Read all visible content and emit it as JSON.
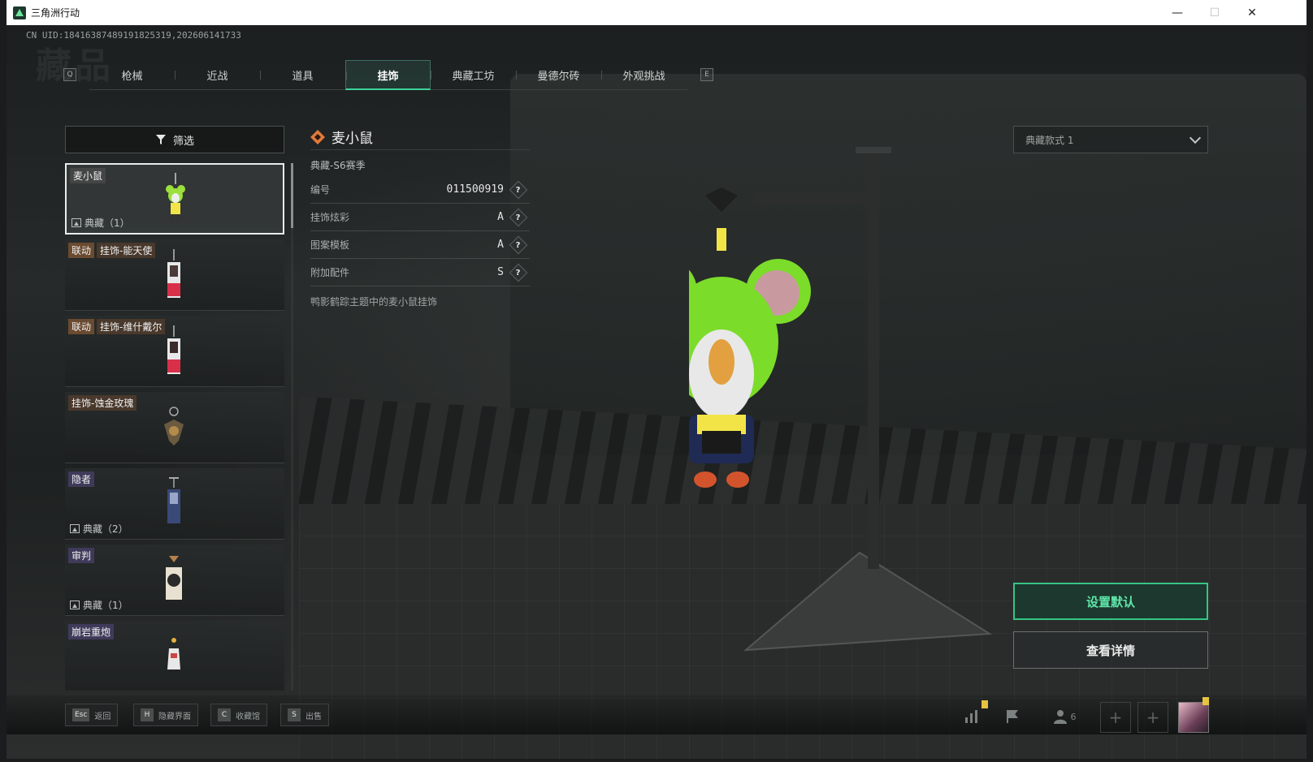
{
  "window": {
    "title": "三角洲行动",
    "min": "—",
    "max": "☐",
    "close": "✕"
  },
  "uid": "CN UID:18416387489191825319,202606141733",
  "watermark": "藏品",
  "tabs": [
    {
      "label": "枪械",
      "active": false
    },
    {
      "label": "近战",
      "active": false
    },
    {
      "label": "道具",
      "active": false
    },
    {
      "label": "挂饰",
      "active": true
    },
    {
      "label": "典藏工坊",
      "active": false
    },
    {
      "label": "曼德尔砖",
      "active": false
    },
    {
      "label": "外观挑战",
      "active": false
    }
  ],
  "tab_keys": {
    "left": "Q",
    "right": "E"
  },
  "filter": {
    "label": "筛选"
  },
  "items": [
    {
      "tags": [],
      "label": "麦小鼠",
      "collect": "典藏（1）",
      "selected": true,
      "rarity": ""
    },
    {
      "tags": [
        "联动"
      ],
      "label": "挂饰-能天使",
      "collect": "",
      "selected": false,
      "rarity": "orange"
    },
    {
      "tags": [
        "联动"
      ],
      "label": "挂饰-维什戴尔",
      "collect": "",
      "selected": false,
      "rarity": "orange"
    },
    {
      "tags": [],
      "label": "挂饰-蚀金玫瑰",
      "collect": "",
      "selected": false,
      "rarity": "orange"
    },
    {
      "tags": [],
      "label": "隐者",
      "collect": "典藏（2）",
      "selected": false,
      "rarity": "purple"
    },
    {
      "tags": [],
      "label": "审判",
      "collect": "典藏（1）",
      "selected": false,
      "rarity": "purple"
    },
    {
      "tags": [],
      "label": "崩岩重炮",
      "collect": "",
      "selected": false,
      "rarity": "purple"
    }
  ],
  "detail": {
    "name": "麦小鼠",
    "season": "典藏-S6赛季",
    "rows": [
      {
        "key": "编号",
        "value": "011500919"
      },
      {
        "key": "挂饰炫彩",
        "value": "A"
      },
      {
        "key": "图案模板",
        "value": "A"
      },
      {
        "key": "附加配件",
        "value": "S"
      }
    ],
    "help": "?",
    "description": "鸭影鹤踪主题中的麦小鼠挂饰"
  },
  "style_select": {
    "value": "典藏款式 1"
  },
  "actions": {
    "set_default": "设置默认",
    "view_detail": "查看详情"
  },
  "hotkeys": [
    {
      "key": "Esc",
      "label": "返回"
    },
    {
      "key": "H",
      "label": "隐藏界面"
    },
    {
      "key": "C",
      "label": "收藏馆"
    },
    {
      "key": "S",
      "label": "出售"
    }
  ],
  "system_bar": {
    "friends_count": "6",
    "plus": "+"
  },
  "colors": {
    "accent": "#35c585",
    "accent_text": "#5fe6a8",
    "mascot_green": "#7cdc2a"
  }
}
